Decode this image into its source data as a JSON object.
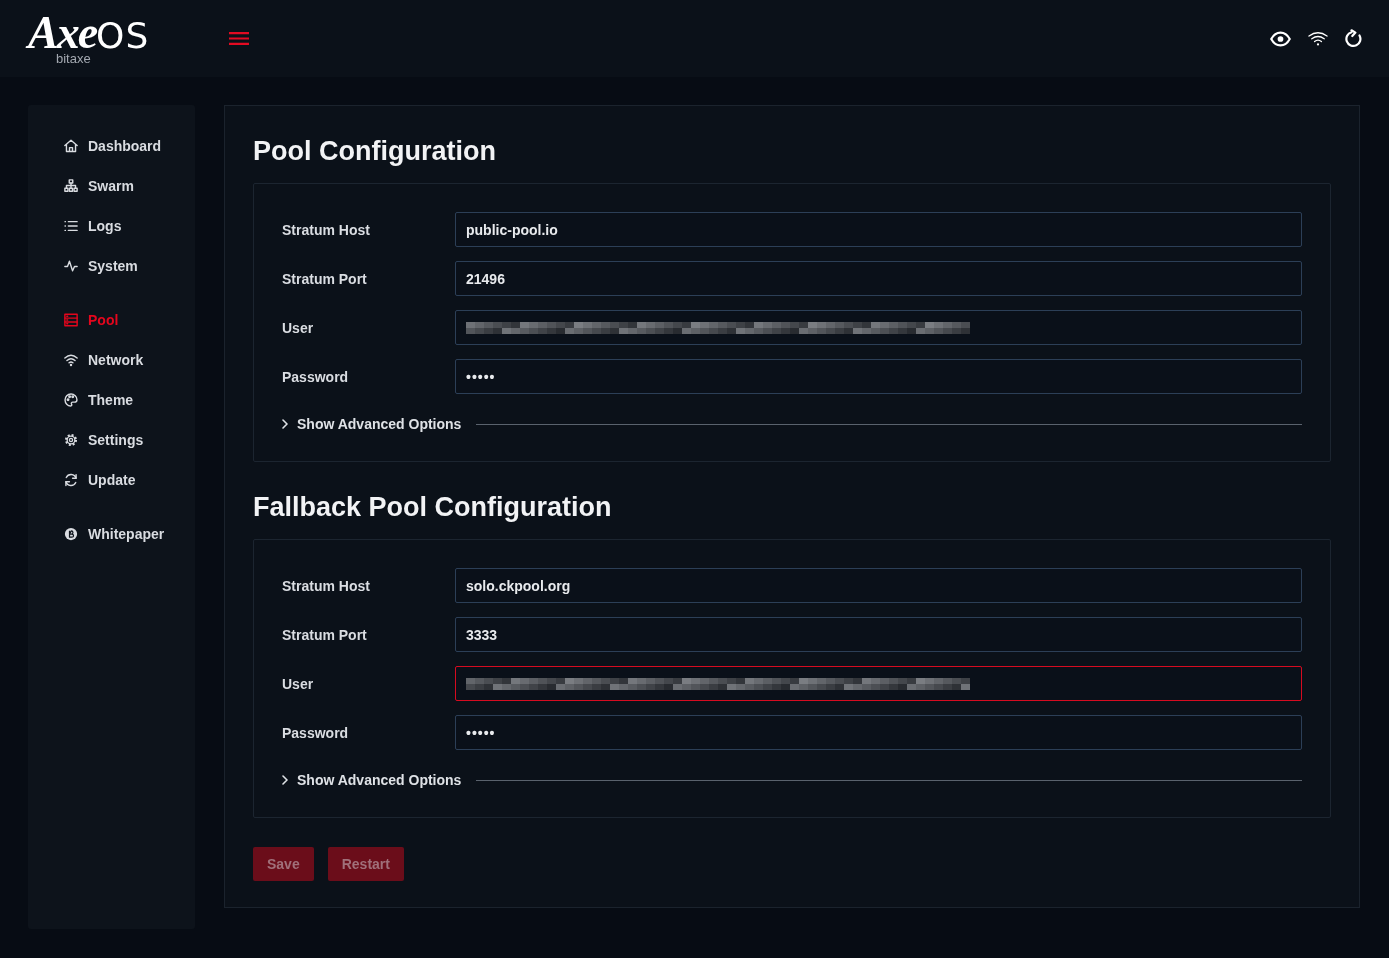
{
  "header": {
    "logo": {
      "wordmark": "**Axe**OS",
      "caption": "bitaxe"
    }
  },
  "sidebar": {
    "groups": [
      {
        "items": [
          {
            "label": "Dashboard",
            "selected": false
          },
          {
            "label": "Swarm",
            "selected": false
          },
          {
            "label": "Logs",
            "selected": false
          },
          {
            "label": "System",
            "selected": false
          }
        ]
      },
      {
        "items": [
          {
            "label": "Pool",
            "selected": true
          },
          {
            "label": "Network",
            "selected": false
          },
          {
            "label": "Theme",
            "selected": false
          },
          {
            "label": "Settings",
            "selected": false
          },
          {
            "label": "Update",
            "selected": false
          }
        ]
      },
      {
        "items": [
          {
            "label": "Whitepaper",
            "selected": false
          }
        ]
      }
    ]
  },
  "sections": [
    {
      "title": "Pool Configuration",
      "fields": [
        {
          "label": "Stratum Host",
          "kind": "text",
          "value": "public-pool.io",
          "invalid": false
        },
        {
          "label": "Stratum Port",
          "kind": "text",
          "value": "21496",
          "invalid": false
        },
        {
          "label": "User",
          "kind": "redacted",
          "invalid": false
        },
        {
          "label": "Password",
          "kind": "masked",
          "value": "•••••",
          "invalid": false
        }
      ],
      "advanced": {
        "label": "Show Advanced Options",
        "expanded": false
      }
    },
    {
      "title": "Fallback Pool Configuration",
      "fields": [
        {
          "label": "Stratum Host",
          "kind": "text",
          "value": "solo.ckpool.org",
          "invalid": false
        },
        {
          "label": "Stratum Port",
          "kind": "text",
          "value": "3333",
          "invalid": false
        },
        {
          "label": "User",
          "kind": "redacted",
          "invalid": true
        },
        {
          "label": "Password",
          "kind": "masked",
          "value": "•••••",
          "invalid": false
        }
      ],
      "advanced": {
        "label": "Show Advanced Options",
        "expanded": false
      }
    }
  ],
  "buttons": [
    {
      "label": "Save",
      "disabled": true
    },
    {
      "label": "Restart",
      "disabled": true
    }
  ]
}
